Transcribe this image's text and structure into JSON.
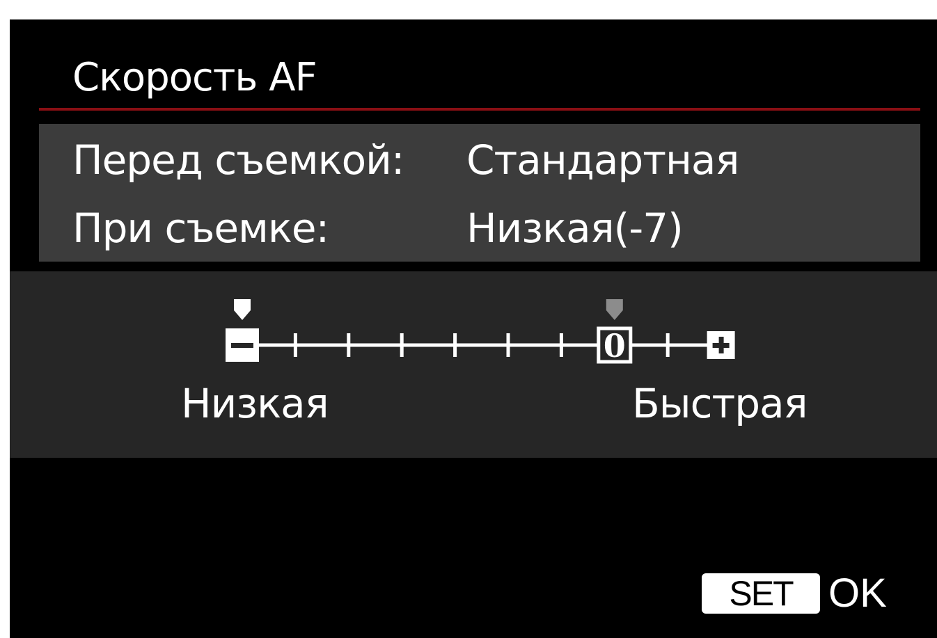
{
  "screen": {
    "title": "Скорость AF",
    "accent_color": "#8a0f14"
  },
  "settings": [
    {
      "label": "Перед съемкой:",
      "value": "Стандартная"
    },
    {
      "label": "При съемке:",
      "value": "Низкая(-7)"
    }
  ],
  "scale": {
    "min": -7,
    "max": 2,
    "current": -7,
    "default": 0,
    "minus_icon": "minus-icon",
    "plus_icon": "plus-icon",
    "zero_label": "0",
    "low_label": "Низкая",
    "fast_label": "Быстрая"
  },
  "footer": {
    "set_label": "SET",
    "ok_label": "OK"
  }
}
